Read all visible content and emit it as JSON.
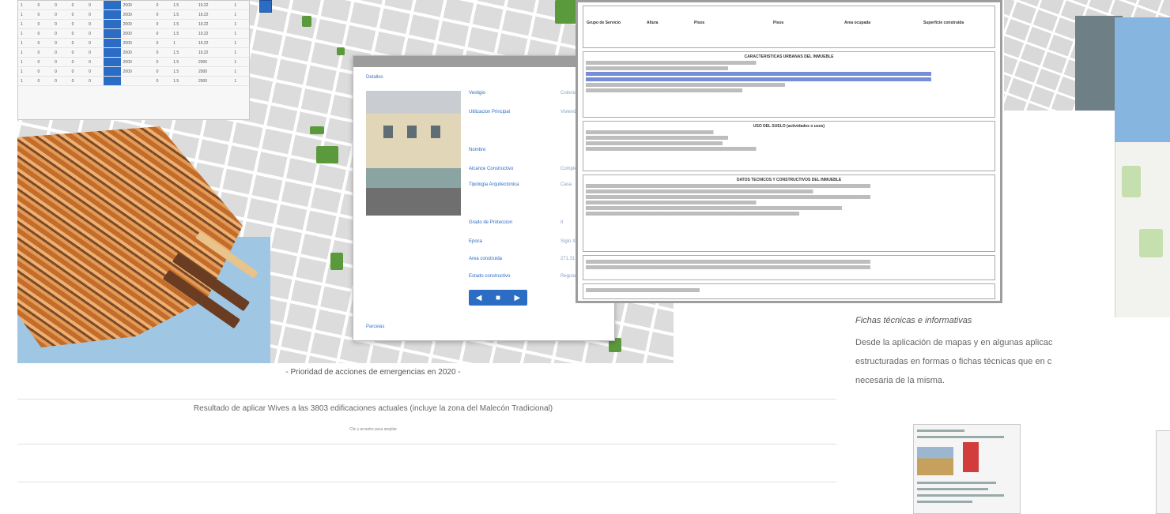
{
  "collage": {
    "table_rows": [
      [
        "1",
        "0",
        "0",
        "0",
        "0",
        "",
        "2000",
        "0",
        "1.5",
        "19.22",
        "1"
      ],
      [
        "1",
        "0",
        "0",
        "0",
        "0",
        "",
        "2000",
        "0",
        "1.5",
        "19.22",
        "1"
      ],
      [
        "1",
        "0",
        "0",
        "0",
        "0",
        "",
        "2000",
        "0",
        "1.5",
        "19.22",
        "1"
      ],
      [
        "1",
        "0",
        "0",
        "0",
        "0",
        "",
        "2000",
        "0",
        "1.5",
        "19.22",
        "1"
      ],
      [
        "1",
        "0",
        "0",
        "0",
        "0",
        "",
        "2000",
        "0",
        "1",
        "19.22",
        "1"
      ],
      [
        "1",
        "0",
        "0",
        "0",
        "0",
        "",
        "2000",
        "0",
        "1.5",
        "19.22",
        "1"
      ],
      [
        "1",
        "0",
        "0",
        "0",
        "0",
        "",
        "2000",
        "0",
        "1.5",
        "2000",
        "1"
      ],
      [
        "1",
        "0",
        "0",
        "0",
        "0",
        "",
        "2000",
        "0",
        "1.5",
        "2000",
        "1"
      ],
      [
        "1",
        "0",
        "0",
        "0",
        "0",
        "",
        "",
        "0",
        "1.5",
        "2000",
        "1"
      ]
    ],
    "popup": {
      "top_link": "Detalles",
      "bottom_link": "Parcelas",
      "fields": [
        "Vestigio",
        "Utilizacion Principal",
        "Nombre",
        "Alcance Constructivo",
        "Tipologia Arquitectonica",
        "Grado de Proteccion",
        "Epoca",
        "Area construida",
        "Estado constructivo"
      ],
      "values": [
        "Colonial",
        "Vivienda",
        "",
        "Completa",
        "Casa",
        "II",
        "Siglo XIX",
        "271.31",
        "Regular"
      ],
      "nav_prev": "◀",
      "nav_mid": "■",
      "nav_next": "▶"
    },
    "sheet": {
      "top_labels": [
        "Grupo de Servicio",
        "Altura",
        "Pisos",
        "Pisos",
        "Area ocupada",
        "Superficie construida"
      ],
      "section_titles": [
        "CARACTERISTICAS URBANAS DEL INMUEBLE",
        "USO DEL SUELO (actividades o usos)",
        "DATOS TECNICOS Y CONSTRUCTIVOS DEL INMUEBLE"
      ]
    }
  },
  "captions": {
    "main": "- Prioridad de acciones de emergencias en 2020 -",
    "result": "Resultado de aplicar Wives a las 3803 edificaciones actuales (incluye la zona del Malecón Tradicional)",
    "tiny": "Clic y arrastre para ampliar"
  },
  "right": {
    "title": "Fichas técnicas e informativas",
    "body_lines": [
      "Desde la aplicación de mapas y en algunas aplicac",
      "estructuradas en formas o fichas técnicas que en c",
      "necesaria de la misma."
    ]
  },
  "colors": {
    "accent_blue": "#2b6cc4",
    "park_green": "#5b9a3c",
    "water_blue": "#a8cbe6"
  }
}
